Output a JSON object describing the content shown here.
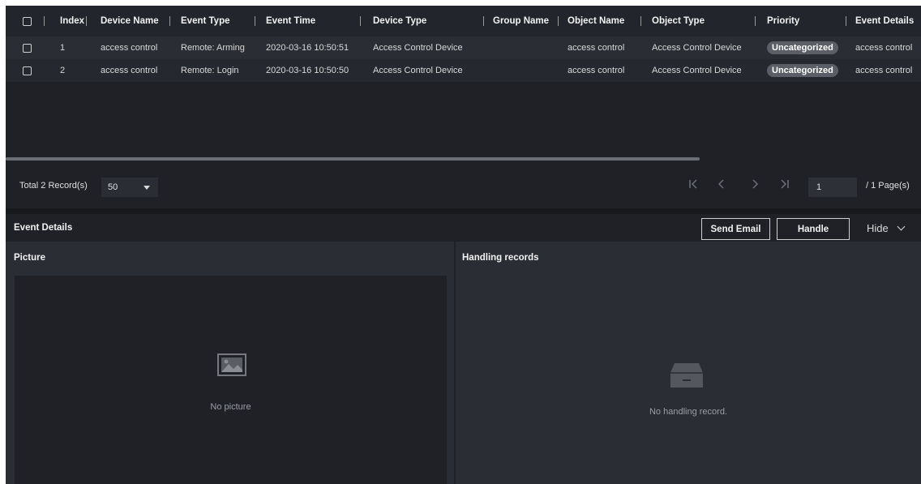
{
  "table": {
    "columns": [
      "Index",
      "Device Name",
      "Event Type",
      "Event Time",
      "Device Type",
      "Group Name",
      "Object Name",
      "Object Type",
      "Priority",
      "Event Details"
    ],
    "rows": [
      {
        "index": "1",
        "device_name": "access control",
        "event_type": "Remote: Arming",
        "event_time": "2020-03-16 10:50:51",
        "device_type": "Access Control Device",
        "group_name": "",
        "object_name": "access control",
        "object_type": "Access Control Device",
        "priority": "Uncategorized",
        "event_details": "access control"
      },
      {
        "index": "2",
        "device_name": "access control",
        "event_type": "Remote: Login",
        "event_time": "2020-03-16 10:50:50",
        "device_type": "Access Control Device",
        "group_name": "",
        "object_name": "access control",
        "object_type": "Access Control Device",
        "priority": "Uncategorized",
        "event_details": "access control"
      }
    ]
  },
  "pagination": {
    "total_label": "Total 2 Record(s)",
    "page_size": "50",
    "first_icon": "first-page-icon",
    "prev_icon": "prev-page-icon",
    "next_icon": "next-page-icon",
    "last_icon": "last-page-icon",
    "current_page": "1",
    "total_pages_label": "/ 1 Page(s)"
  },
  "event_details": {
    "title": "Event Details",
    "send_email_label": "Send Email",
    "handle_label": "Handle",
    "hide_label": "Hide"
  },
  "picture_panel": {
    "title": "Picture",
    "empty_text": "No picture",
    "icon": "image-placeholder-icon"
  },
  "handling_panel": {
    "title": "Handling records",
    "empty_text": "No handling record.",
    "icon": "empty-tray-icon"
  },
  "colors": {
    "background": "#1f2126",
    "row_alt": "#2a2d33",
    "badge": "#5b5e66",
    "text": "#e6e6e6"
  }
}
